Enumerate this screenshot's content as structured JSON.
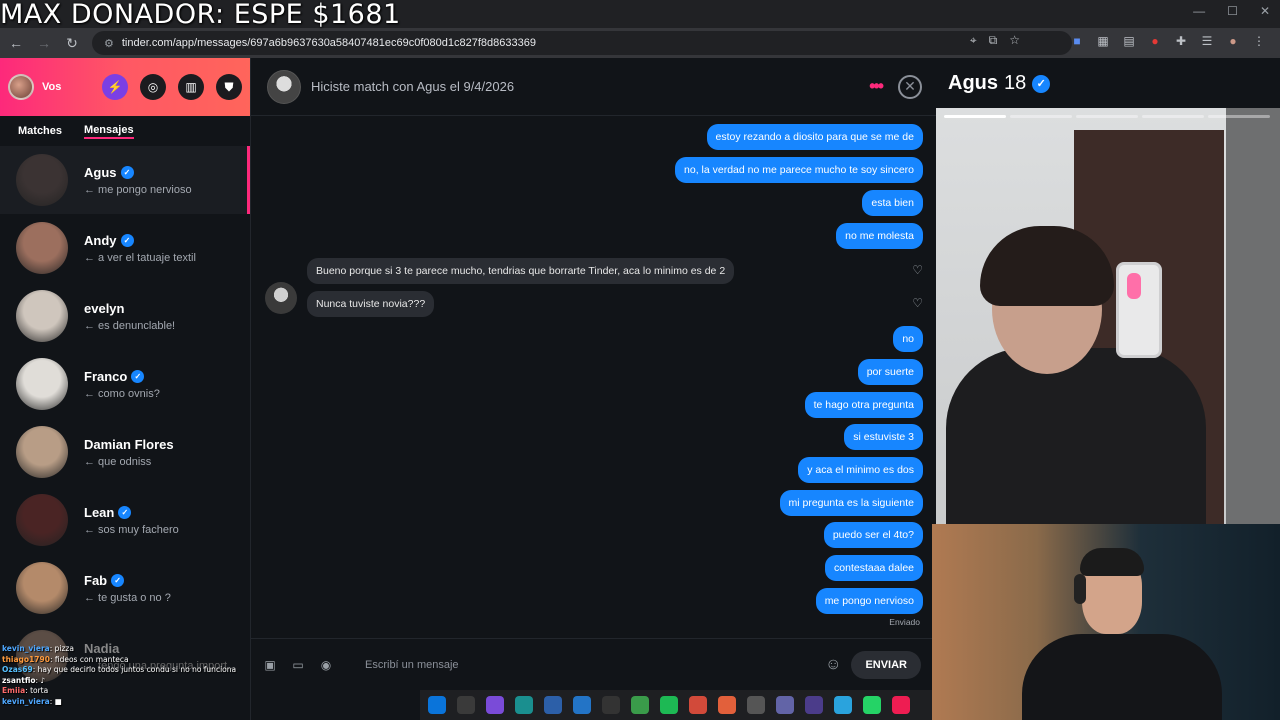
{
  "overlay": {
    "title": "MAX DONADOR: ESPE $1681"
  },
  "browser": {
    "url": "tinder.com/app/messages/697a6b9637630a58407481ec69c0f080d1c827f8d8633369",
    "back_icon": "arrow-left-icon",
    "forward_icon": "arrow-right-icon",
    "reload_icon": "reload-icon"
  },
  "sidebar": {
    "user_label": "Vos",
    "tabs": [
      {
        "label": "Matches",
        "active": false
      },
      {
        "label": "Mensajes",
        "active": true
      }
    ],
    "matches": [
      {
        "name": "Agus",
        "verified": true,
        "last": "← me pongo nervioso",
        "active": true,
        "color": "#3b3333"
      },
      {
        "name": "Andy",
        "verified": true,
        "last": "← a ver el tatuaje textil",
        "active": false,
        "color": "#9c6f5e"
      },
      {
        "name": "evelyn",
        "verified": false,
        "last": "← es denunclable!",
        "active": false,
        "color": "#cfc6bd"
      },
      {
        "name": "Franco",
        "verified": true,
        "last": "← como ovnis?",
        "active": false,
        "color": "#e0ddd8"
      },
      {
        "name": "Damian Flores",
        "verified": false,
        "last": "← que odniss",
        "active": false,
        "color": "#b89d86"
      },
      {
        "name": "Lean",
        "verified": true,
        "last": "← sos muy fachero",
        "active": false,
        "color": "#4a2424"
      },
      {
        "name": "Fab",
        "verified": true,
        "last": "← te gusta o no ?",
        "active": false,
        "color": "#b48a6a"
      },
      {
        "name": "Nadia",
        "verified": false,
        "last": "← tengo una pregunta import...",
        "active": false,
        "color": "#5b4d45"
      }
    ]
  },
  "chat": {
    "header_title": "Hiciste match con Agus el 9/4/2026",
    "sent_label": "Enviado",
    "messages": [
      {
        "dir": "out",
        "text": "estoy rezando a diosito para que se me de"
      },
      {
        "dir": "out",
        "text": "no, la verdad no me parece mucho te soy sincero"
      },
      {
        "dir": "out",
        "text": "esta bien"
      },
      {
        "dir": "out",
        "text": "no me molesta"
      },
      {
        "dir": "in",
        "text": "Bueno porque si 3 te parece mucho, tendrias que borrarte Tinder, aca lo minimo es de 2"
      },
      {
        "dir": "in",
        "text": "Nunca tuviste novia???"
      },
      {
        "dir": "out",
        "text": "no"
      },
      {
        "dir": "out",
        "text": "por suerte"
      },
      {
        "dir": "out",
        "text": "te hago otra pregunta"
      },
      {
        "dir": "out",
        "text": "si estuviste 3"
      },
      {
        "dir": "out",
        "text": "y aca el minimo es dos"
      },
      {
        "dir": "out",
        "text": "mi pregunta es la siguiente"
      },
      {
        "dir": "out",
        "text": "puedo ser el 4to?"
      },
      {
        "dir": "out",
        "text": "contestaaa dalee"
      },
      {
        "dir": "out",
        "text": "me pongo nervioso"
      }
    ],
    "composer_placeholder": "Escribí un mensaje",
    "send_label": "ENVIAR"
  },
  "profile": {
    "name": "Agus",
    "age": "18",
    "verified": true
  },
  "stream_chat": [
    {
      "user": "kevin_viera",
      "color": "#4fa8ff",
      "text": ": pizza"
    },
    {
      "user": "thiago1790",
      "color": "#ff9b3d",
      "text": ": fideos con manteca"
    },
    {
      "user": "Ozas69",
      "color": "#57c1ff",
      "text": ": hay que decirlo todos juntos condu si no no funciona"
    },
    {
      "user": "zsantfio",
      "color": "#ffffff",
      "text": ": ♪"
    },
    {
      "user": "Emiia",
      "color": "#ff6b6b",
      "text": ": torta"
    },
    {
      "user": "kevin_viera",
      "color": "#4fa8ff",
      "text": ": ■"
    }
  ],
  "taskbar": [
    {
      "icon": "windows-icon",
      "color": "#0a74da"
    },
    {
      "icon": "file-explorer-icon",
      "color": "#3a3a3a"
    },
    {
      "icon": "copilot-icon",
      "color": "#7a4bd8"
    },
    {
      "icon": "edge-icon",
      "color": "#1a8f8f"
    },
    {
      "icon": "store-icon",
      "color": "#2c5fa8"
    },
    {
      "icon": "vscode-icon",
      "color": "#2374c6"
    },
    {
      "icon": "obs-icon",
      "color": "#333333"
    },
    {
      "icon": "chrome-icon",
      "color": "#3a9b4a"
    },
    {
      "icon": "spotify-icon",
      "color": "#1db954"
    },
    {
      "icon": "chrome-profile-icon",
      "color": "#d24a3a"
    },
    {
      "icon": "brave-icon",
      "color": "#e2603b"
    },
    {
      "icon": "app-icon",
      "color": "#555555"
    },
    {
      "icon": "teams-icon",
      "color": "#6264a7"
    },
    {
      "icon": "circle-app-icon",
      "color": "#4b3c8a"
    },
    {
      "icon": "telegram-icon",
      "color": "#2aa3dd"
    },
    {
      "icon": "whatsapp-icon",
      "color": "#25d366"
    },
    {
      "icon": "tiktok-icon",
      "color": "#ee1d52"
    }
  ],
  "colors": {
    "accent": "#fd297b",
    "bubble_out": "#1786ff",
    "bubble_in": "#2a2d33"
  }
}
